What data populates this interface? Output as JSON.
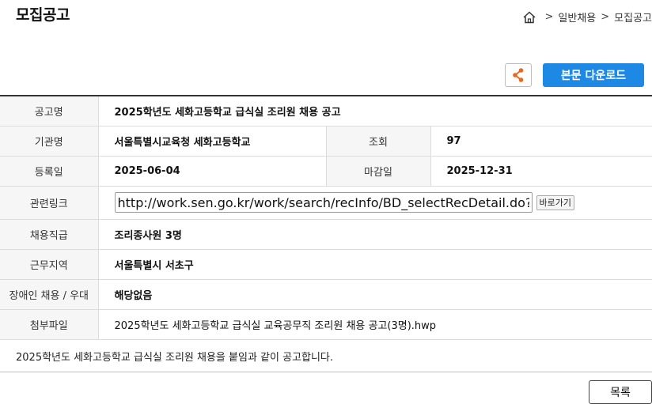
{
  "header": {
    "title": "모집공고",
    "breadcrumb": {
      "separator": ">",
      "items": [
        "일반채용",
        "모집공고"
      ]
    }
  },
  "toolbar": {
    "share_icon": "share-icon",
    "download_label": "본문 다운로드",
    "accent_color": "#1e88e5",
    "share_icon_color": "#e8671c"
  },
  "details": {
    "title_label": "공고명",
    "title_value": "2025학년도 세화고등학교 급식실 조리원 채용 공고",
    "agency_label": "기관명",
    "agency_value": "서울특별시교육청 세화고등학교",
    "views_label": "조회",
    "views_value": "97",
    "registered_label": "등록일",
    "registered_value": "2025-06-04",
    "deadline_label": "마감일",
    "deadline_value": "2025-12-31",
    "link_label": "관련링크",
    "link_value": "http://work.sen.go.kr/work/search/recInfo/BD_selectRecDetail.do?q_rcrtSn=",
    "go_label": "바로가기",
    "position_label": "채용직급",
    "position_value": "조리종사원 3명",
    "region_label": "근무지역",
    "region_value": "서울특별시 서초구",
    "disability_label": "장애인 채용 / 우대",
    "disability_value": "해당없음",
    "attachment_label": "첨부파일",
    "attachment_value": "2025학년도 세화고등학교 급식실 교육공무직 조리원 채용 공고(3명).hwp"
  },
  "notice": "2025학년도 세화고등학교 급식실 조리원 채용을 붙임과 같이 공고합니다.",
  "footer": {
    "list_label": "목록"
  }
}
